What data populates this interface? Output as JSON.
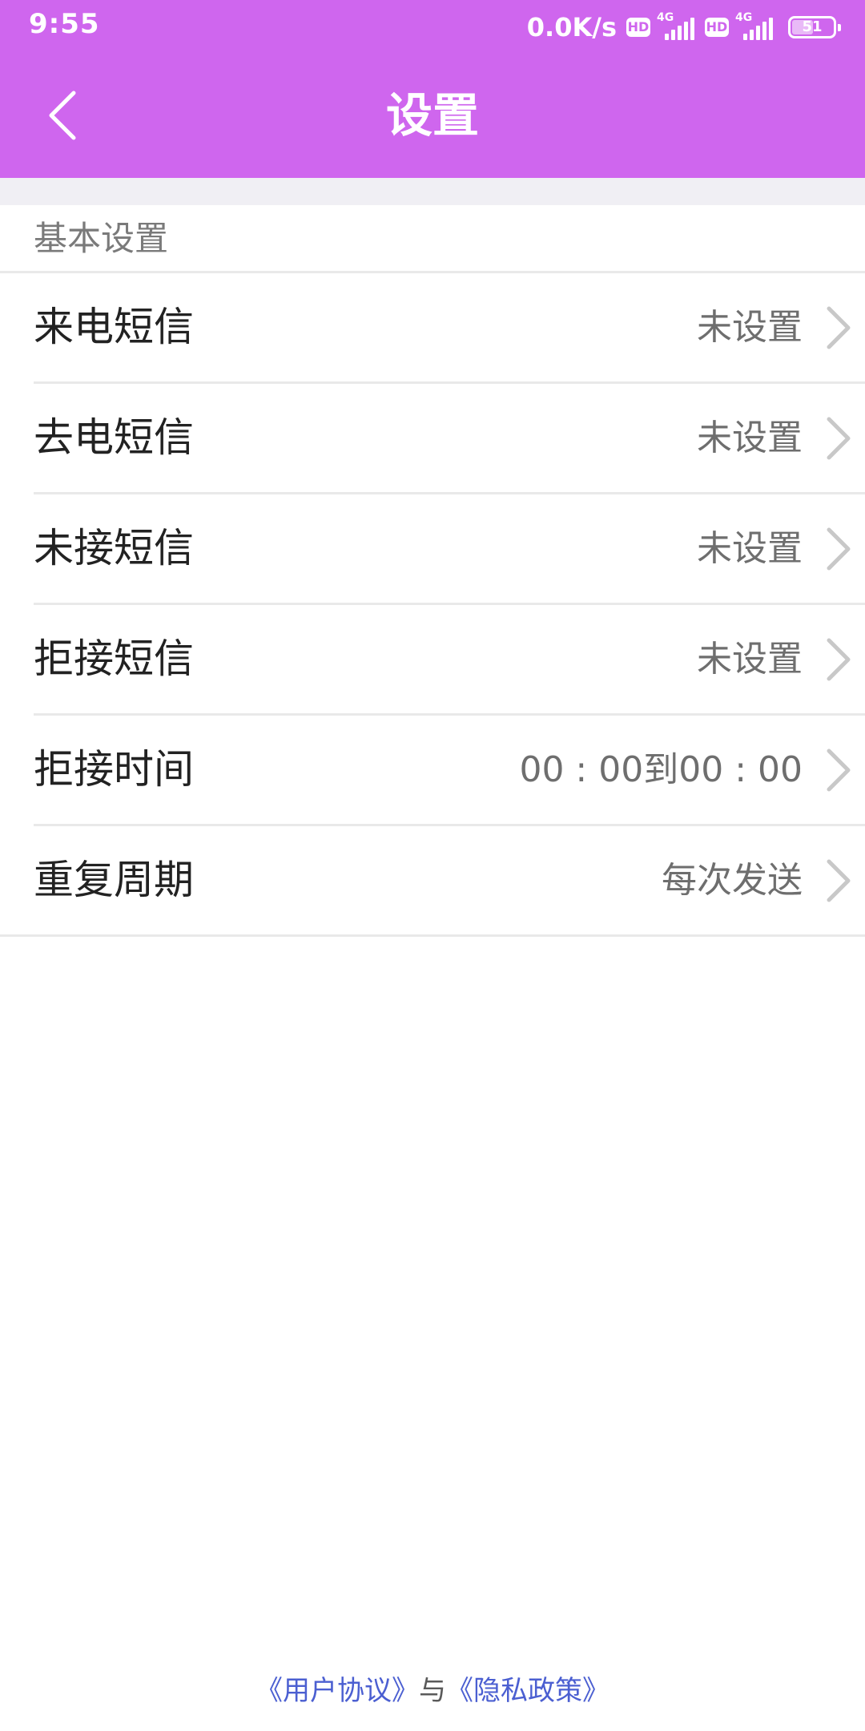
{
  "status_bar": {
    "time": "9:55",
    "net_speed": "0.0K/s",
    "hd_label": "HD",
    "network_type": "4G",
    "battery_level": "51"
  },
  "header": {
    "title": "设置"
  },
  "section": {
    "title": "基本设置"
  },
  "settings": [
    {
      "label": "来电短信",
      "value": "未设置"
    },
    {
      "label": "去电短信",
      "value": "未设置"
    },
    {
      "label": "未接短信",
      "value": "未设置"
    },
    {
      "label": "拒接短信",
      "value": "未设置"
    },
    {
      "label": "拒接时间",
      "value": "00 : 00到00 : 00"
    },
    {
      "label": "重复周期",
      "value": "每次发送"
    }
  ],
  "footer": {
    "user_agreement": "《用户协议》",
    "connector": "与",
    "privacy_policy": "《隐私政策》"
  },
  "colors": {
    "header_bg": "#cf66ee",
    "link": "#4b5fd1"
  }
}
